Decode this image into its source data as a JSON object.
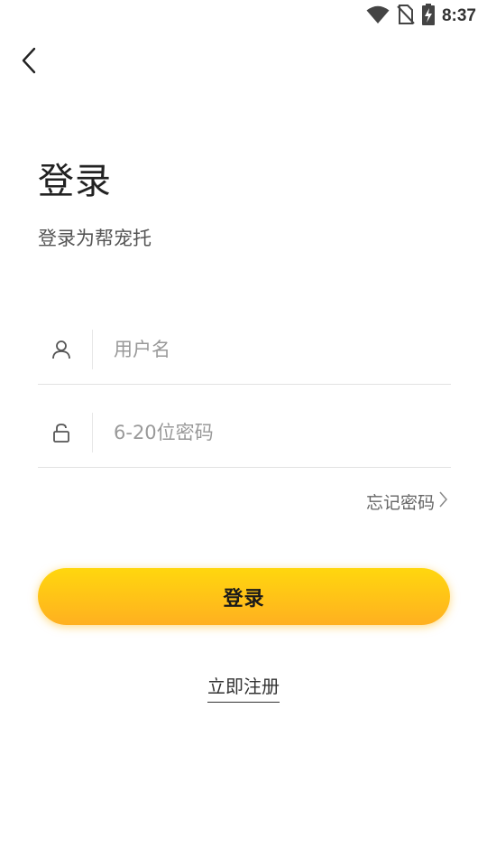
{
  "status_bar": {
    "time": "8:37",
    "icons": [
      "wifi-icon",
      "no-sim-icon",
      "battery-charging-icon"
    ]
  },
  "nav": {
    "back_icon": "chevron-left-icon"
  },
  "header": {
    "title": "登录",
    "subtitle": "登录为帮宠托"
  },
  "form": {
    "username": {
      "icon": "user-icon",
      "placeholder": "用户名",
      "value": ""
    },
    "password": {
      "icon": "lock-icon",
      "placeholder": "6-20位密码",
      "value": ""
    },
    "forgot_label": "忘记密码"
  },
  "actions": {
    "login_label": "登录",
    "register_label": "立即注册"
  },
  "colors": {
    "button_gradient_top": "#ffd70e",
    "button_gradient_bottom": "#ffb020"
  }
}
